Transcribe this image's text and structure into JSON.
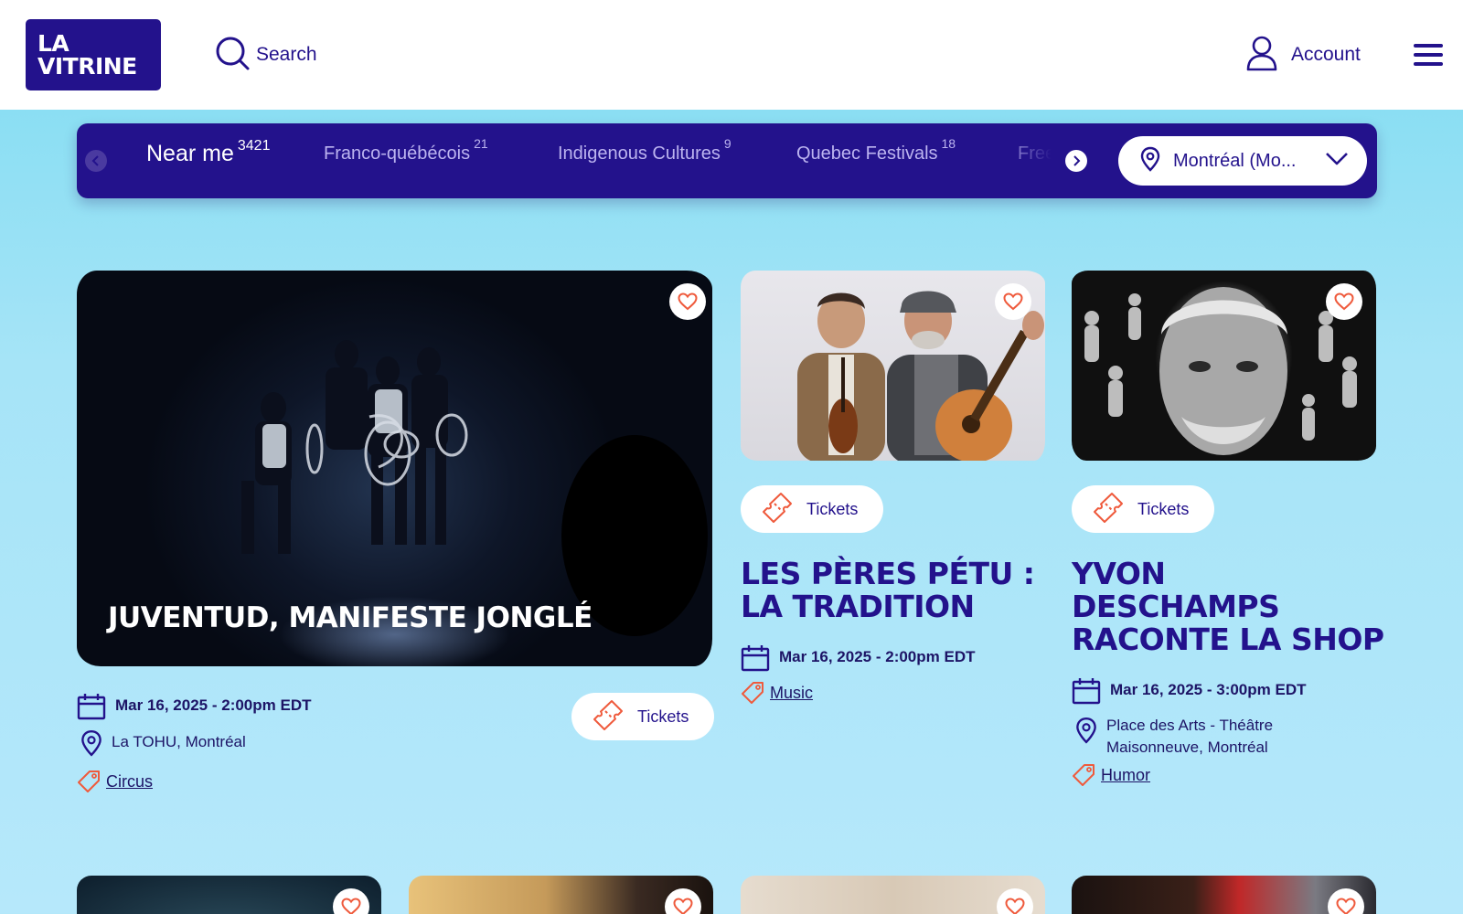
{
  "header": {
    "logo_line1": "LA",
    "logo_line2": "VITRINE",
    "search_label": "Search",
    "account_label": "Account"
  },
  "filters": {
    "categories": [
      {
        "label": "Near me",
        "count": "3421",
        "active": true
      },
      {
        "label": "Franco-québécois",
        "count": "21"
      },
      {
        "label": "Indigenous Cultures",
        "count": "9"
      },
      {
        "label": "Quebec Festivals",
        "count": "18"
      },
      {
        "label": "Free",
        "count": ""
      }
    ],
    "location_label": "Montréal (Mo..."
  },
  "cards": [
    {
      "title": "JUVENTUD, MANIFESTE JONGLÉ",
      "date": "Mar 16, 2025 - 2:00pm EDT",
      "location": "La TOHU, Montréal",
      "category": "Circus",
      "ticket_label": "Tickets"
    },
    {
      "title_line1": "LES PÈRES PÉTU :",
      "title_line2": "LA TRADITION",
      "date": "Mar 16, 2025 - 2:00pm EDT",
      "category": "Music",
      "ticket_label": "Tickets"
    },
    {
      "title_line1": "YVON",
      "title_line2": "DESCHAMPS",
      "title_line3": "RACONTE LA SHOP",
      "date": "Mar 16, 2025 - 3:00pm EDT",
      "location_line1": "Place des Arts - Théâtre",
      "location_line2": "Maisonneuve, Montréal",
      "category": "Humor",
      "ticket_label": "Tickets"
    }
  ],
  "colors": {
    "brand": "#23128c",
    "accent": "#ef5a3c",
    "background_top": "#7fdcf1",
    "background_bottom": "#b6e8fb"
  },
  "icons": [
    "search-icon",
    "user-icon",
    "hamburger-icon",
    "chevron-left-icon",
    "chevron-right-icon",
    "location-pin-icon",
    "chevron-down-icon",
    "heart-icon",
    "ticket-icon",
    "calendar-icon",
    "tag-icon"
  ]
}
